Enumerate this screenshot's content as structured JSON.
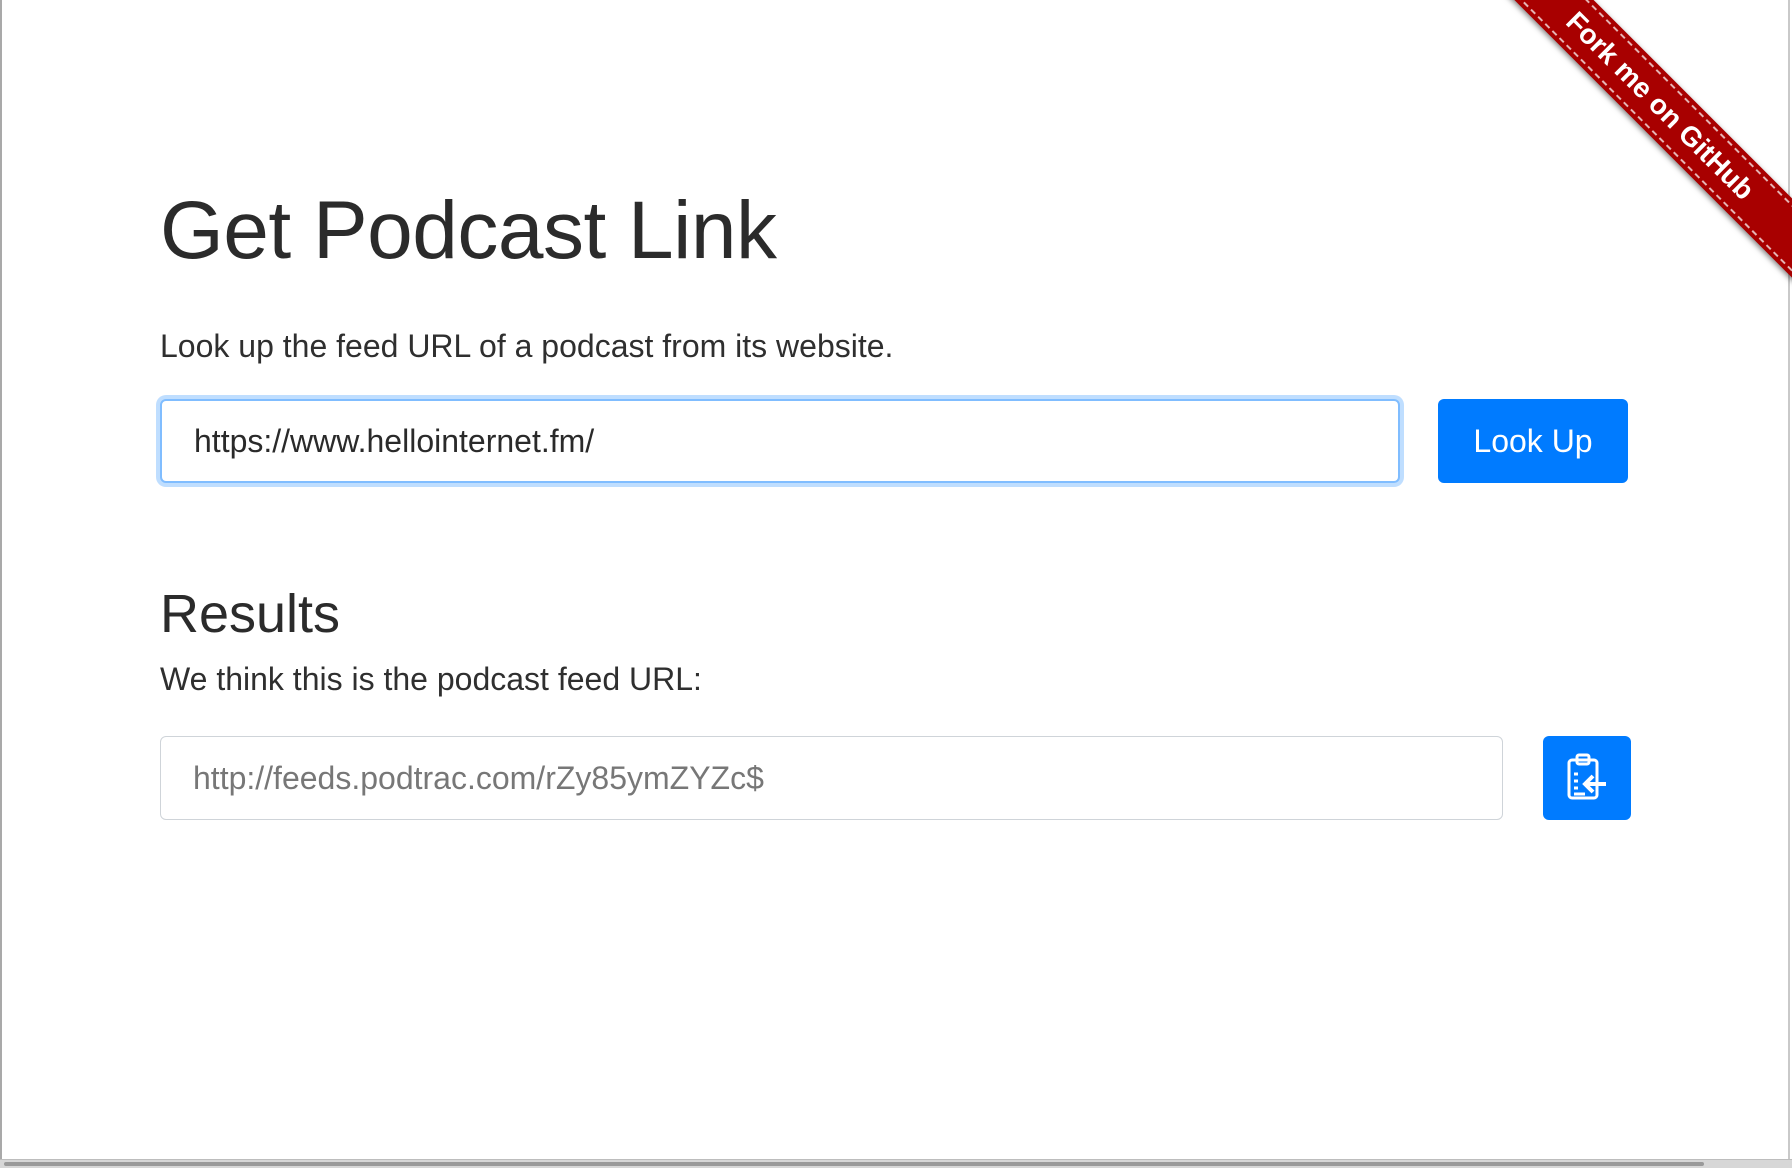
{
  "ribbon": {
    "label": "Fork me on GitHub"
  },
  "header": {
    "title": "Get Podcast Link",
    "lead": "Look up the feed URL of a podcast from its website."
  },
  "lookup": {
    "input_value": "https://www.hellointernet.fm/",
    "button_label": "Look Up"
  },
  "results": {
    "title": "Results",
    "description": "We think this is the podcast feed URL:",
    "feed_url": "http://feeds.podtrac.com/rZy85ymZYZc$",
    "copy_icon": "clipboard-copy-icon"
  },
  "colors": {
    "primary": "#007bff",
    "ribbon": "#a80000",
    "focus_border": "#80bdff"
  }
}
